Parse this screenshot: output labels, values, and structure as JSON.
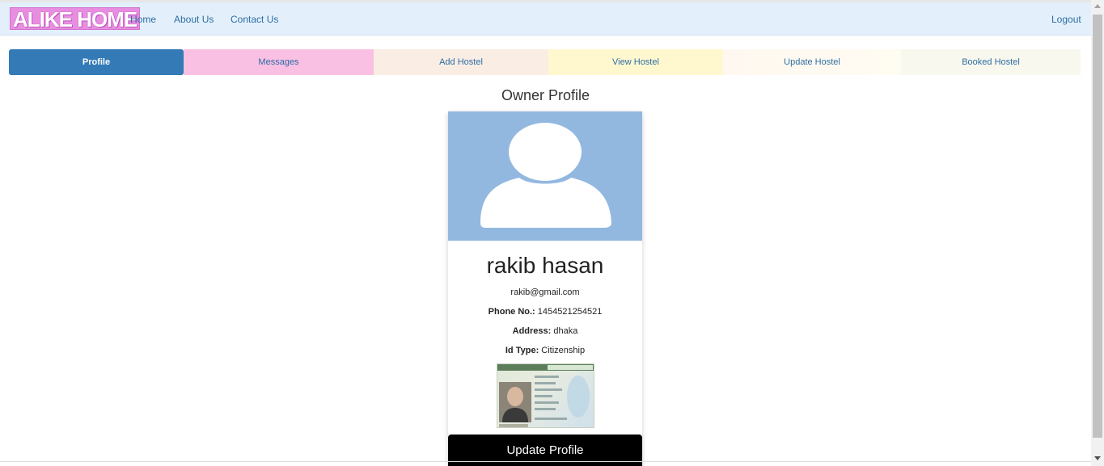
{
  "navbar": {
    "brand": "ALIKE HOME",
    "links": [
      "Home",
      "About Us",
      "Contact Us"
    ],
    "logout": "Logout"
  },
  "tabs": [
    {
      "label": "Profile",
      "color": "#337ab7",
      "active": true
    },
    {
      "label": "Messages",
      "color": "#f9c0e4",
      "active": false
    },
    {
      "label": "Add Hostel",
      "color": "#f9ede4",
      "active": false
    },
    {
      "label": "View Hostel",
      "color": "#fff8cf",
      "active": false
    },
    {
      "label": "Update Hostel",
      "color": "#fff9ee",
      "active": false
    },
    {
      "label": "Booked Hostel",
      "color": "#f8f8ee",
      "active": false
    }
  ],
  "page_title": "Owner Profile",
  "profile": {
    "avatar_icon": "user-silhouette-icon",
    "name": "rakib hasan",
    "email": "rakib@gmail.com",
    "phone_label": "Phone No.:",
    "phone": "1454521254521",
    "address_label": "Address:",
    "address": "dhaka",
    "id_type_label": "Id Type:",
    "id_type": "Citizenship",
    "update_button": "Update Profile"
  },
  "colors": {
    "navbar_bg": "#e3f0fb",
    "link": "#2e6da4",
    "avatar_bg": "#93b8e0",
    "button_bg": "#000000"
  }
}
